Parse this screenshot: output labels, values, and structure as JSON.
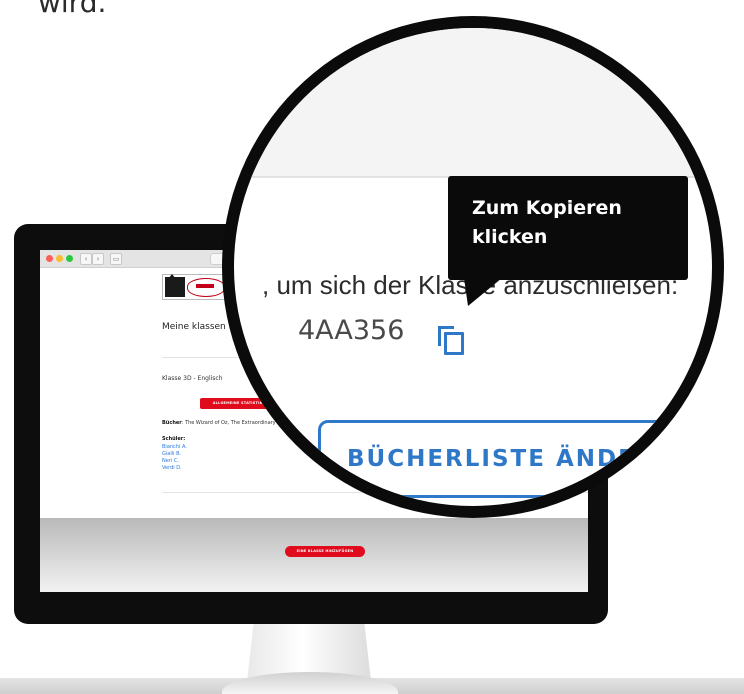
{
  "intro": {
    "text": "wird."
  },
  "screen": {
    "page_title": "Meine klassen",
    "class_name": "Klasse 3D - Englisch",
    "stats_button": "ALLGEMEINE STATISTIK DER KL",
    "books_label": "Bücher",
    "books_list": ": The Wizard of Oz, The Extraordinary Mo",
    "students_label": "Schüler:",
    "students": [
      "Bianchi A.",
      "Gialli B.",
      "Neri C.",
      "Verdi D."
    ],
    "add_class_button": "EINE KLASSE HINZUFÜGEN",
    "accent_red": "#e00b1c"
  },
  "magnifier": {
    "instruction": ", um sich der Klasse anzuschließen:",
    "class_code": "4AA356",
    "copy_icon": "copy-icon",
    "tooltip_line1": "Zum Kopieren",
    "tooltip_line2": "klicken",
    "edit_books_button": "BÜCHERLISTE ÄNDERN",
    "accent_blue": "#2f78c8"
  }
}
